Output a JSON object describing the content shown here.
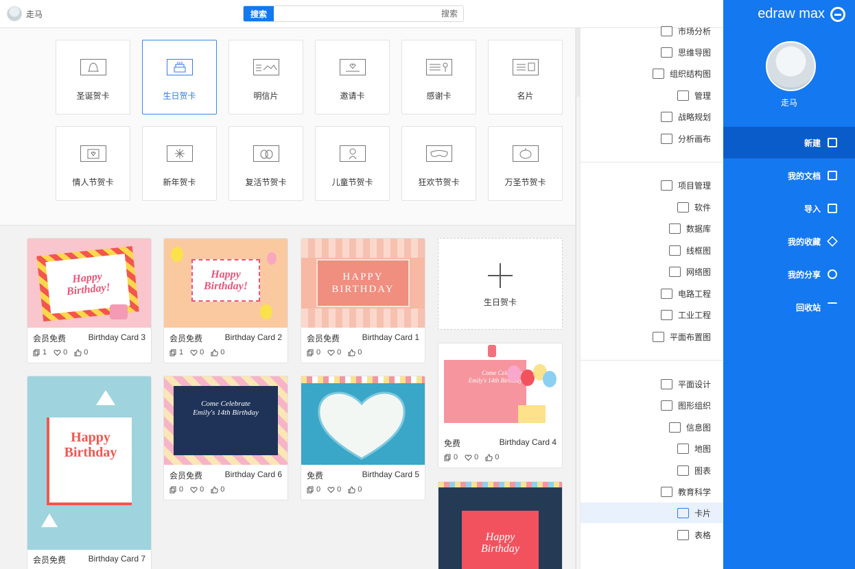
{
  "app": {
    "brand": "edraw max",
    "user_name": "走马"
  },
  "search": {
    "button": "搜索",
    "placeholder": "搜索"
  },
  "categories_row1": [
    "名片",
    "感谢卡",
    "邀请卡",
    "明信片",
    "生日贺卡",
    "圣诞贺卡"
  ],
  "categories_row2": [
    "万圣节贺卡",
    "狂欢节贺卡",
    "儿童节贺卡",
    "复活节贺卡",
    "新年贺卡",
    "情人节贺卡"
  ],
  "active_category": "生日贺卡",
  "new_tile_label": "生日贺卡",
  "templates": [
    {
      "name": "Birthday Card 1",
      "price": "会员免费",
      "likes": "0",
      "favs": "0",
      "copies": "0"
    },
    {
      "name": "Birthday Card 2",
      "price": "会员免费",
      "likes": "0",
      "favs": "0",
      "copies": "1"
    },
    {
      "name": "Birthday Card 3",
      "price": "会员免费",
      "likes": "0",
      "favs": "0",
      "copies": "1"
    },
    {
      "name": "Birthday Card 4",
      "price": "免费",
      "likes": "0",
      "favs": "0",
      "copies": "0"
    },
    {
      "name": "Birthday Card 5",
      "price": "免费",
      "likes": "0",
      "favs": "0",
      "copies": "0"
    },
    {
      "name": "Birthday Card 6",
      "price": "会员免费",
      "likes": "0",
      "favs": "0",
      "copies": "0"
    },
    {
      "name": "Birthday Card 7",
      "price": "会员免费"
    }
  ],
  "card_text": {
    "happy_birthday_caps": "HAPPY BIRTHDAY",
    "happy_birthday_script": "Happy Birthday!",
    "come_celebrate": "Come Celebrate",
    "emily": "Emily's 14th Birthday",
    "happy": "Happy",
    "birthday": "Birthday"
  },
  "catlist_group1": [
    "市场分析",
    "思维导图",
    "组织结构图",
    "管理",
    "战略规划",
    "分析画布"
  ],
  "catlist_group2": [
    "项目管理",
    "软件",
    "数据库",
    "线框图",
    "网络图",
    "电路工程",
    "工业工程",
    "平面布置图"
  ],
  "catlist_group3": [
    "平面设计",
    "图形组织",
    "信息图",
    "地图",
    "图表",
    "教育科学",
    "卡片",
    "表格"
  ],
  "nav": [
    "新建",
    "我的文档",
    "导入",
    "我的收藏",
    "我的分享",
    "回收站"
  ],
  "colors": {
    "accent": "#1478f0",
    "nav_active": "#0b5ccb"
  }
}
